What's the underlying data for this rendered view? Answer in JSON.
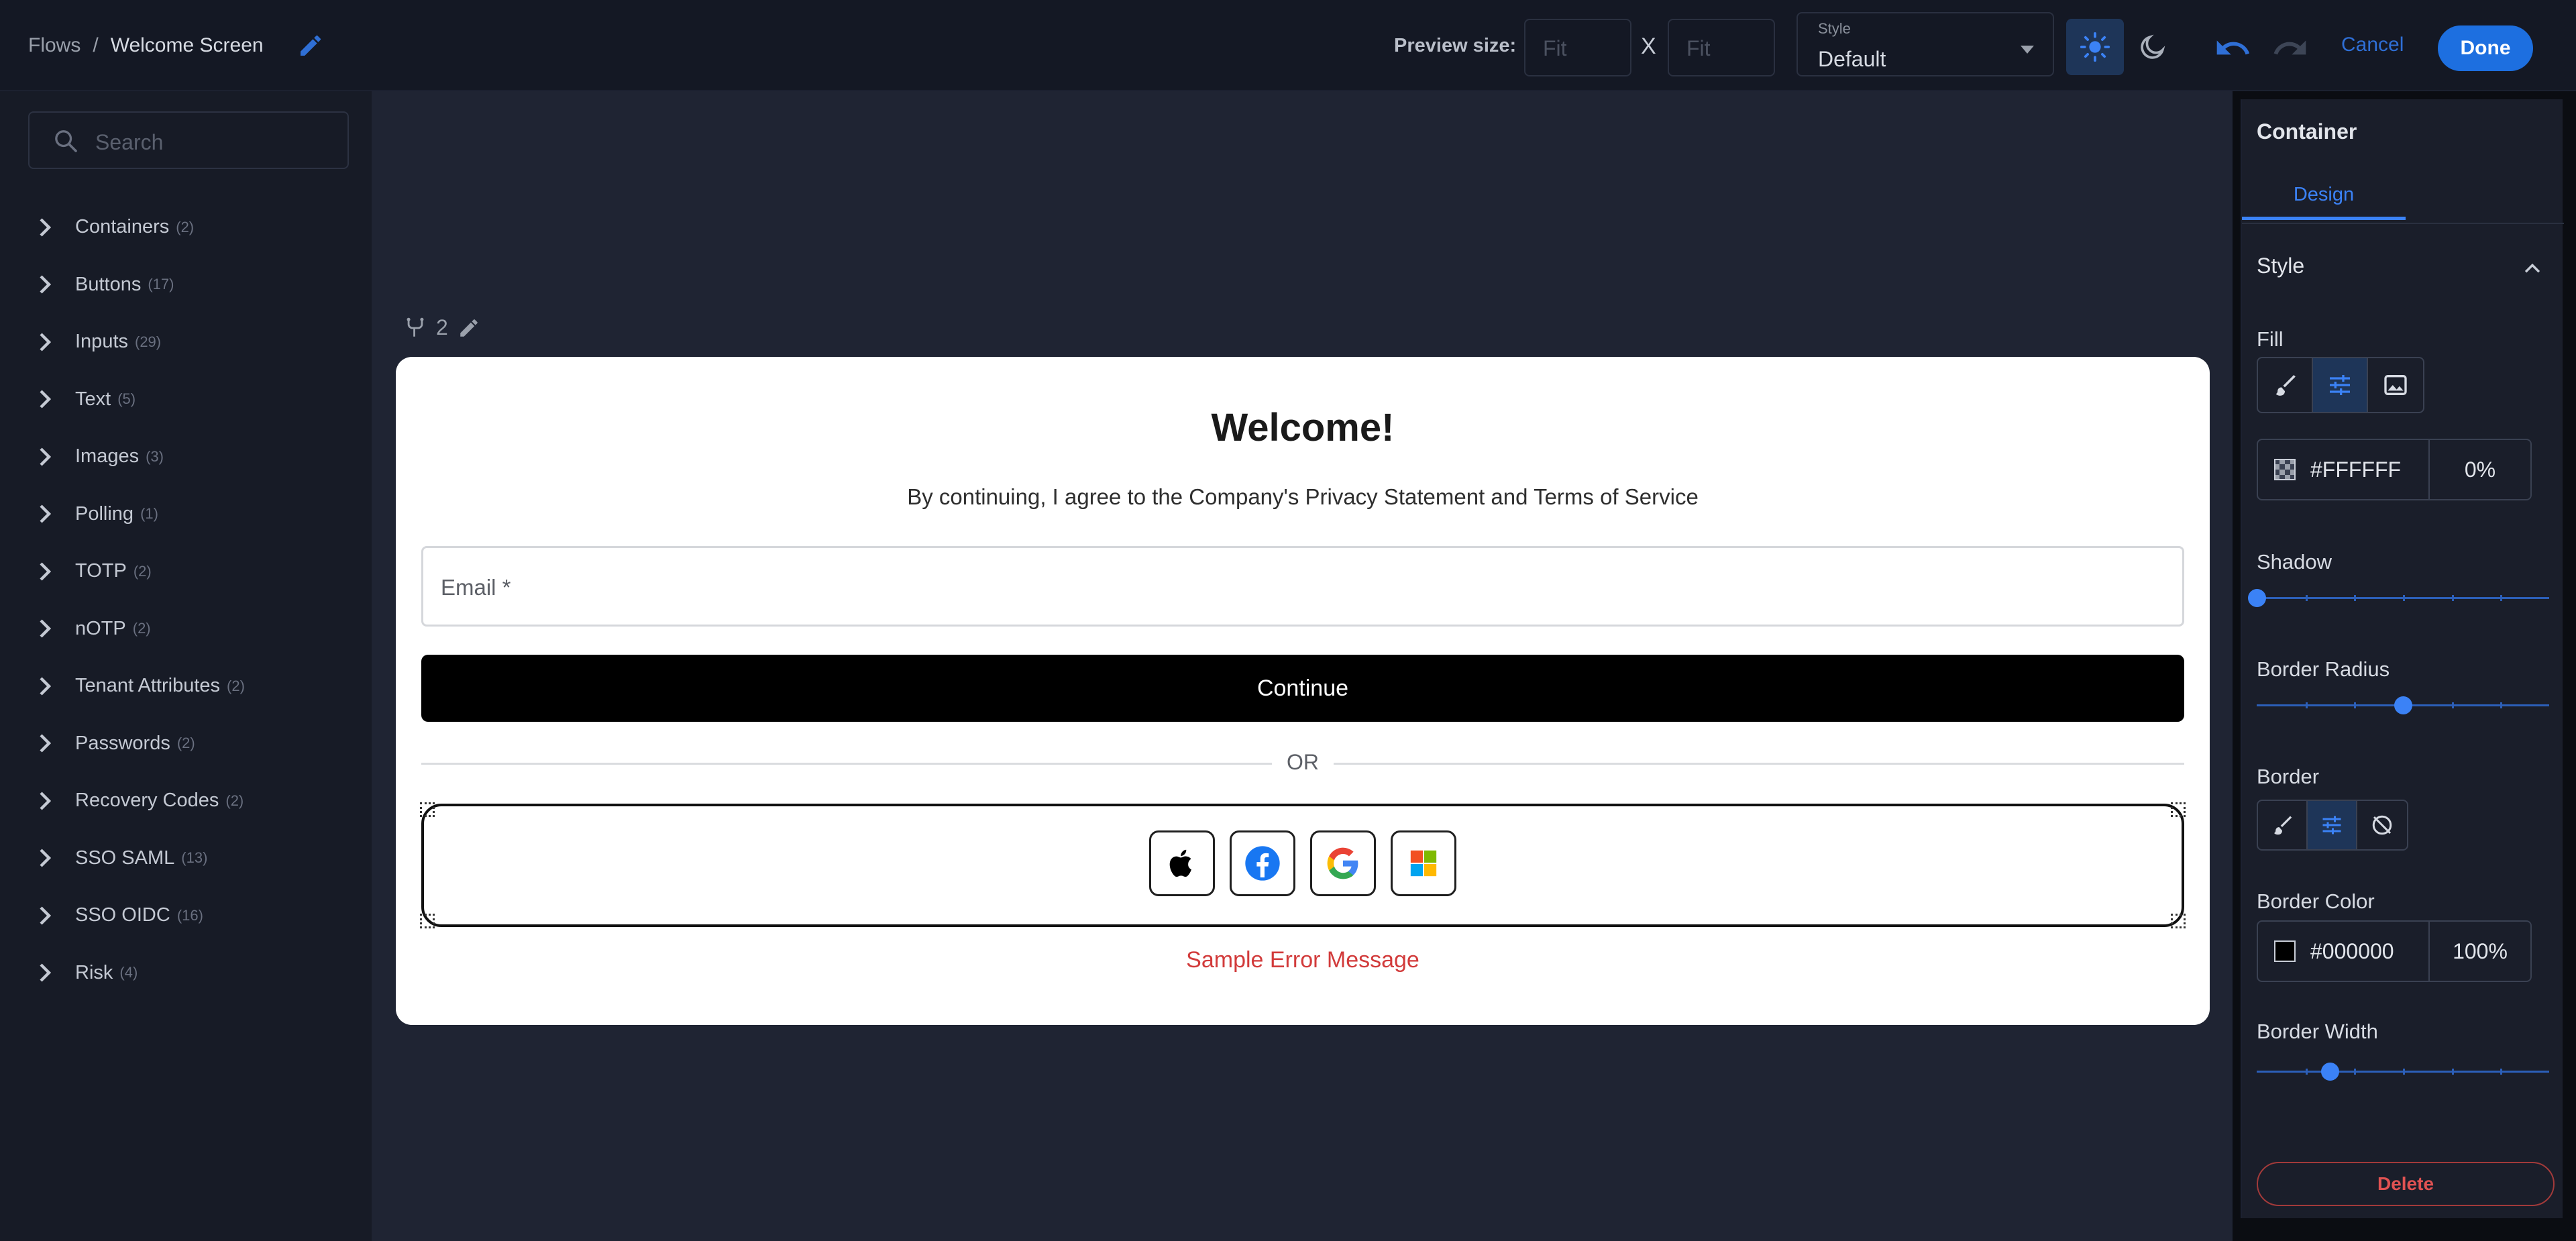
{
  "header": {
    "breadcrumb_root": "Flows",
    "breadcrumb_sep": "/",
    "breadcrumb_current": "Welcome Screen",
    "preview_label": "Preview size:",
    "width_placeholder": "Fit",
    "height_placeholder": "Fit",
    "size_separator": "X",
    "style_label": "Style",
    "style_value": "Default",
    "cancel_label": "Cancel",
    "done_label": "Done"
  },
  "sidebar": {
    "search_placeholder": "Search",
    "items": [
      {
        "label": "Containers",
        "count": "(2)"
      },
      {
        "label": "Buttons",
        "count": "(17)"
      },
      {
        "label": "Inputs",
        "count": "(29)"
      },
      {
        "label": "Text",
        "count": "(5)"
      },
      {
        "label": "Images",
        "count": "(3)"
      },
      {
        "label": "Polling",
        "count": "(1)"
      },
      {
        "label": "TOTP",
        "count": "(2)"
      },
      {
        "label": "nOTP",
        "count": "(2)"
      },
      {
        "label": "Tenant Attributes",
        "count": "(2)"
      },
      {
        "label": "Passwords",
        "count": "(2)"
      },
      {
        "label": "Recovery Codes",
        "count": "(2)"
      },
      {
        "label": "SSO SAML",
        "count": "(13)"
      },
      {
        "label": "SSO OIDC",
        "count": "(16)"
      },
      {
        "label": "Risk",
        "count": "(4)"
      }
    ]
  },
  "canvas": {
    "flow_count": "2",
    "card": {
      "title": "Welcome!",
      "subtitle": "By continuing, I agree to the Company's Privacy Statement and Terms of Service",
      "email_placeholder": "Email *",
      "continue_label": "Continue",
      "divider_label": "OR",
      "social_icons": [
        "apple-icon",
        "facebook-icon",
        "google-icon",
        "microsoft-icon"
      ],
      "error_message": "Sample Error Message"
    }
  },
  "panel": {
    "title": "Container",
    "tab_design": "Design",
    "section_style": "Style",
    "fill_label": "Fill",
    "fill_hex": "#FFFFFF",
    "fill_opacity": "0%",
    "shadow_label": "Shadow",
    "shadow_level": 0,
    "border_radius_label": "Border Radius",
    "border_radius_level": 0.5,
    "border_label": "Border",
    "border_color_label": "Border Color",
    "border_hex": "#000000",
    "border_opacity": "100%",
    "border_width_label": "Border Width",
    "border_width_level": 0.25,
    "delete_label": "Delete"
  },
  "colors": {
    "accent": "#3b82f6",
    "done_button": "#1d6fe0",
    "error": "#d23b3b",
    "delete": "#e05252"
  }
}
